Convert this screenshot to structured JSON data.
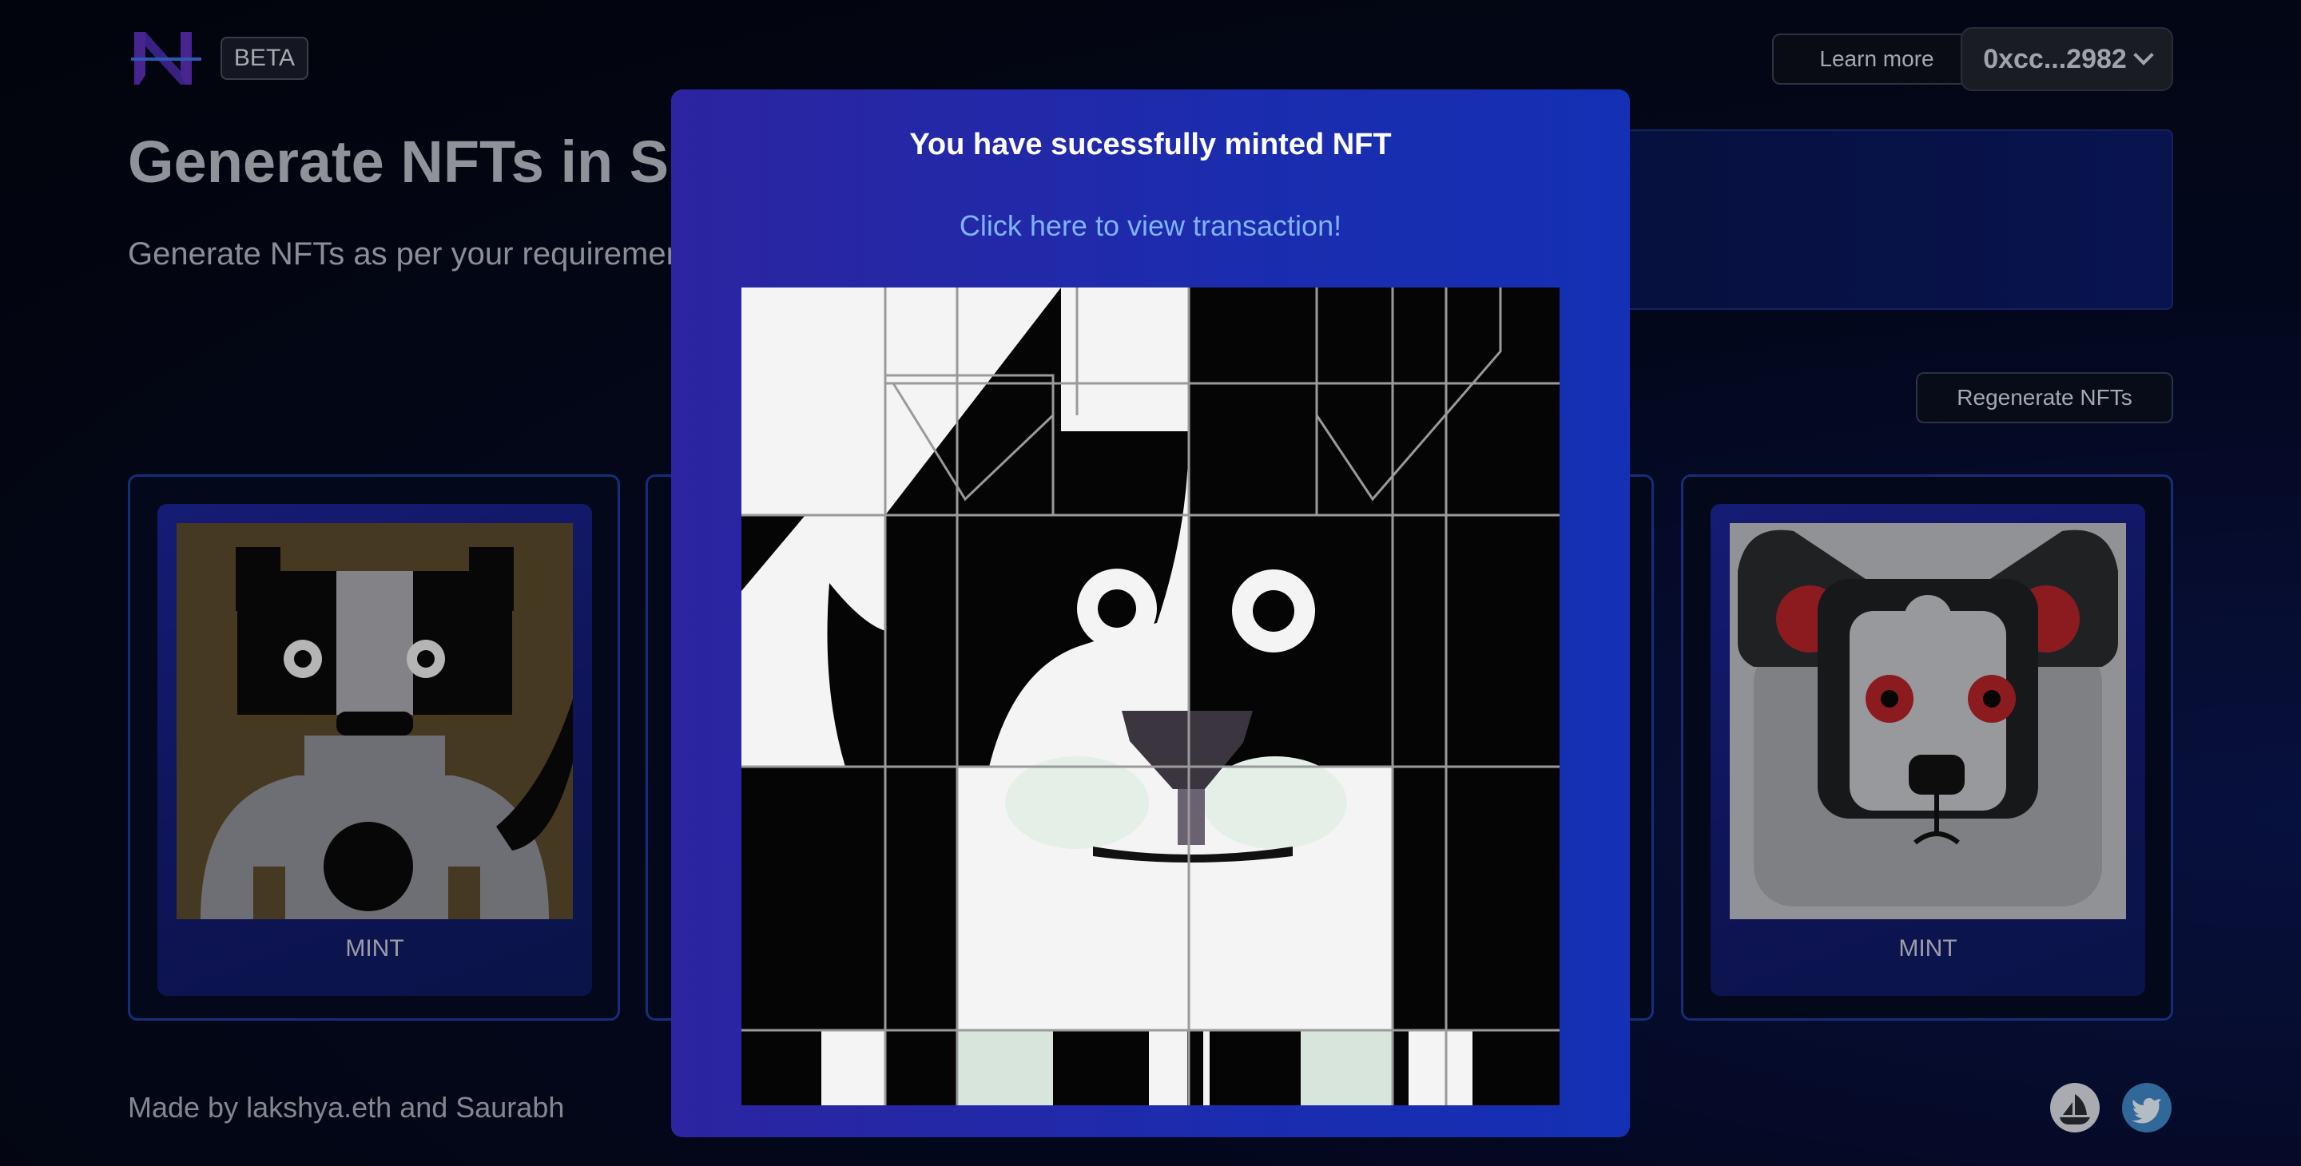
{
  "header": {
    "beta_label": "BETA",
    "learn_more_label": "Learn more",
    "wallet_label": "0xcc...2982"
  },
  "hero": {
    "title": "Generate NFTs in S",
    "subtitle": "Generate NFTs as per your requiremen"
  },
  "actions": {
    "regenerate_label": "Regenerate NFTs"
  },
  "cards": [
    {
      "mint_label": "MINT"
    },
    {
      "mint_label": "MINT"
    }
  ],
  "footer": {
    "credit": "Made by lakshya.eth and Saurabh"
  },
  "modal": {
    "title": "You have sucessfully minted NFT",
    "link_label": "Click here to view transaction!"
  },
  "colors": {
    "accent": "#1c3c99",
    "modal_bg": "#1b2cae",
    "link": "#7fb3ff"
  }
}
